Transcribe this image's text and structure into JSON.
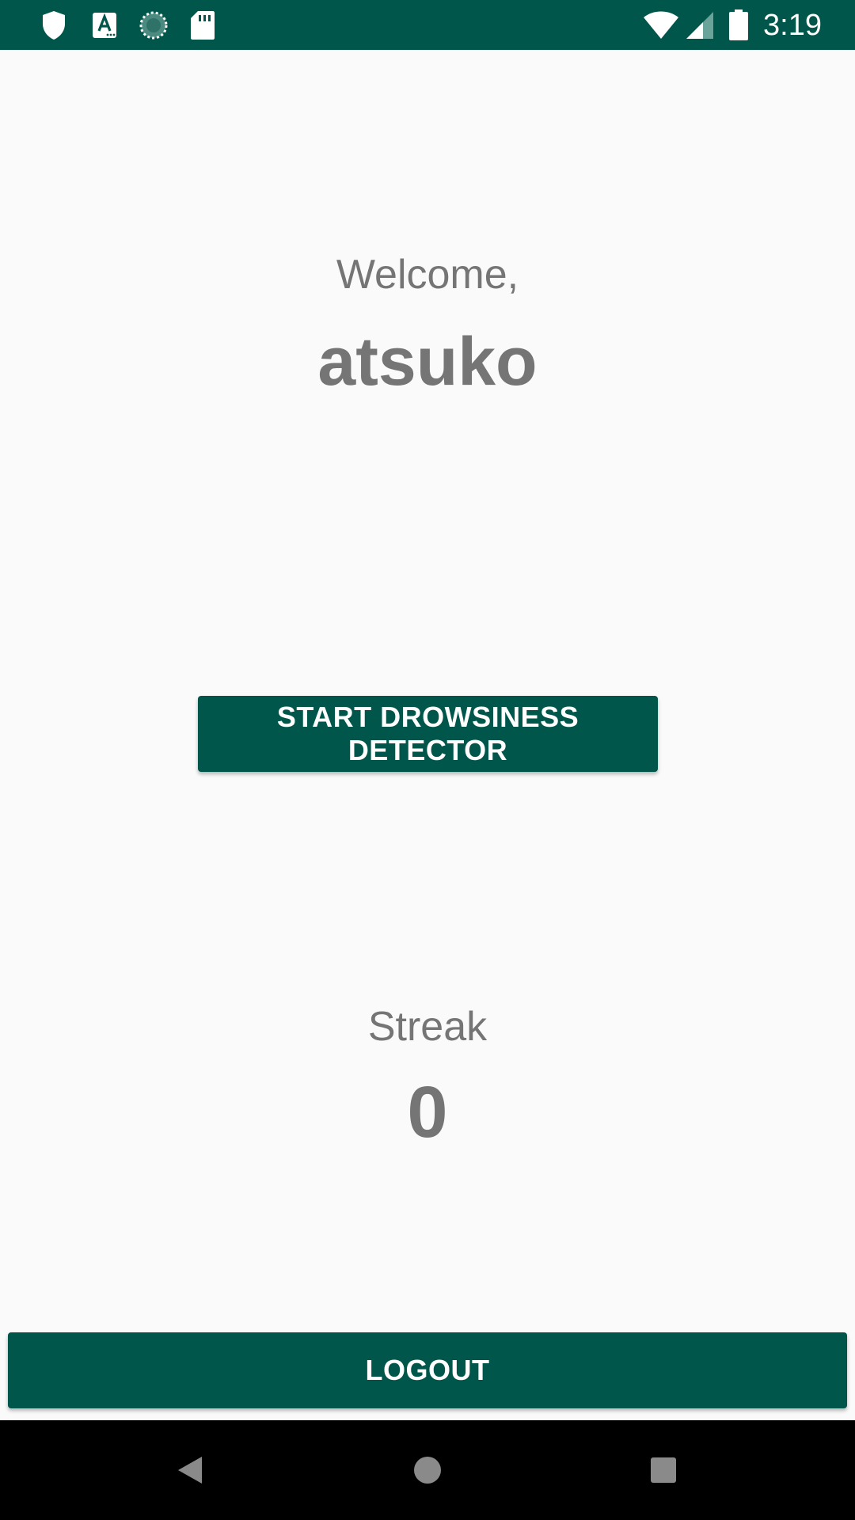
{
  "status_bar": {
    "time": "3:19",
    "left_icons": [
      "shield-icon",
      "text-a-icon",
      "sync-icon",
      "sd-card-icon"
    ],
    "right_icons": [
      "wifi-icon",
      "cell-signal-icon",
      "battery-icon"
    ],
    "background": "#00564a"
  },
  "main": {
    "welcome_label": "Welcome,",
    "username": "atsuko",
    "start_button_label": "START DROWSINESS DETECTOR",
    "streak_label": "Streak",
    "streak_value": "0",
    "logout_button_label": "LOGOUT",
    "accent_color": "#00564a",
    "text_color": "#757575"
  },
  "nav_bar": {
    "icons": [
      "back-icon",
      "home-icon",
      "recents-icon"
    ]
  }
}
